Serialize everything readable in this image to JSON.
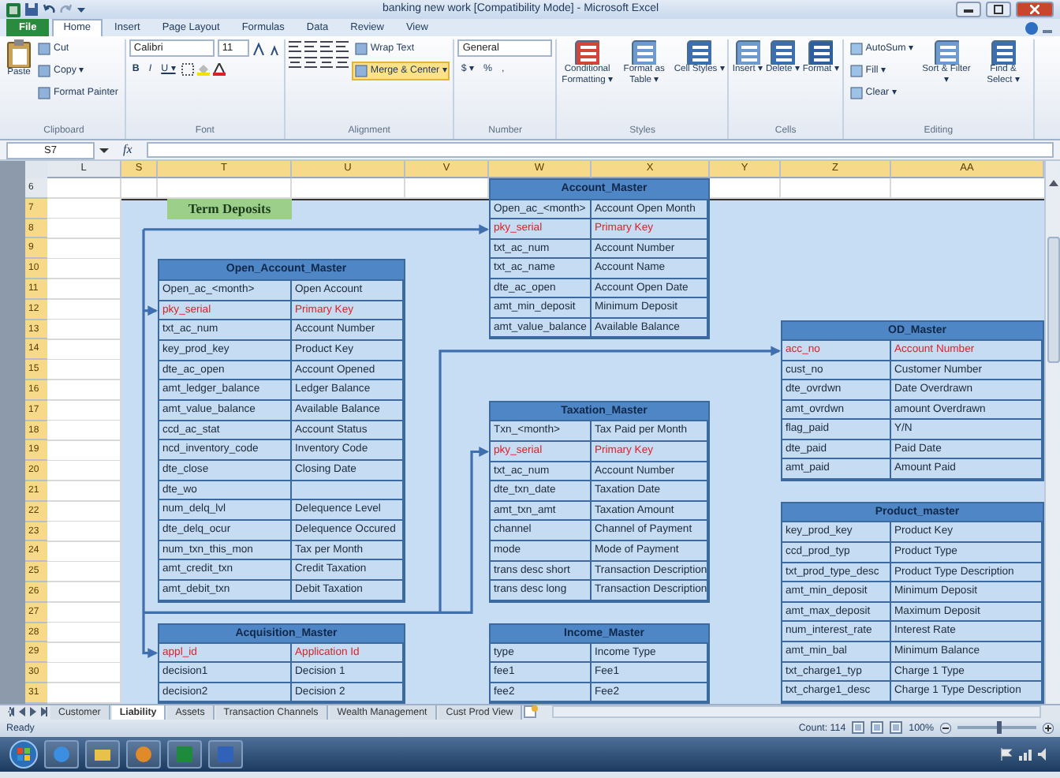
{
  "window": {
    "title": "banking new work [Compatibility Mode] - Microsoft Excel"
  },
  "ribbon": {
    "tabs": [
      {
        "label": "File",
        "selected": false,
        "kind": "file"
      },
      {
        "label": "Home",
        "selected": true,
        "kind": "tab"
      },
      {
        "label": "Insert",
        "selected": false,
        "kind": "tab"
      },
      {
        "label": "Page Layout",
        "selected": false,
        "kind": "tab"
      },
      {
        "label": "Formulas",
        "selected": false,
        "kind": "tab"
      },
      {
        "label": "Data",
        "selected": false,
        "kind": "tab"
      },
      {
        "label": "Review",
        "selected": false,
        "kind": "tab"
      },
      {
        "label": "View",
        "selected": false,
        "kind": "tab"
      }
    ],
    "groups": [
      {
        "kind": "clipboard",
        "label": "Clipboard",
        "big": "Paste",
        "small": [
          "Cut",
          "Copy ▾",
          "Format Painter"
        ]
      },
      {
        "kind": "font",
        "label": "Font",
        "font_name": "Calibri",
        "font_size": "11",
        "buttons": [
          "B",
          "I",
          "U ▾"
        ]
      },
      {
        "kind": "alignment",
        "label": "Alignment",
        "small": [
          {
            "label": "Wrap Text",
            "selected": false
          },
          {
            "label": "Merge & Center ▾",
            "selected": true
          }
        ]
      },
      {
        "kind": "number",
        "label": "Number",
        "format": "General",
        "buttons": [
          "$ ▾",
          "%",
          ","
        ]
      },
      {
        "kind": "big",
        "label": "Styles",
        "big": [
          "Conditional Formatting ▾",
          "Format as Table ▾",
          "Cell Styles ▾"
        ]
      },
      {
        "kind": "big",
        "label": "Cells",
        "big": [
          "Insert ▾",
          "Delete ▾",
          "Format ▾"
        ]
      },
      {
        "kind": "editing",
        "label": "Editing",
        "small": [
          "AutoSum ▾",
          "Fill ▾",
          "Clear ▾"
        ],
        "big": [
          "Sort & Filter ▾",
          "Find & Select ▾"
        ]
      }
    ]
  },
  "formula_bar": {
    "name_box": "S7",
    "fx": "fx"
  },
  "sheet": {
    "columns": [
      {
        "label": "L",
        "selected": false
      },
      {
        "label": "S",
        "selected": true
      },
      {
        "label": "T",
        "selected": true
      },
      {
        "label": "U",
        "selected": true
      },
      {
        "label": "V",
        "selected": true
      },
      {
        "label": "W",
        "selected": true
      },
      {
        "label": "X",
        "selected": true
      },
      {
        "label": "Y",
        "selected": true
      },
      {
        "label": "Z",
        "selected": true
      },
      {
        "label": "AA",
        "selected": true
      }
    ],
    "rows": [
      {
        "label": "6",
        "selected": false
      },
      {
        "label": "7",
        "selected": true
      },
      {
        "label": "8",
        "selected": true
      },
      {
        "label": "9",
        "selected": true
      },
      {
        "label": "10",
        "selected": true
      },
      {
        "label": "11",
        "selected": true
      },
      {
        "label": "12",
        "selected": true
      },
      {
        "label": "13",
        "selected": true
      },
      {
        "label": "14",
        "selected": true
      },
      {
        "label": "15",
        "selected": true
      },
      {
        "label": "16",
        "selected": true
      },
      {
        "label": "17",
        "selected": true
      },
      {
        "label": "18",
        "selected": true
      },
      {
        "label": "19",
        "selected": true
      },
      {
        "label": "20",
        "selected": true
      },
      {
        "label": "21",
        "selected": true
      },
      {
        "label": "22",
        "selected": true
      },
      {
        "label": "23",
        "selected": true
      },
      {
        "label": "24",
        "selected": true
      },
      {
        "label": "25",
        "selected": true
      },
      {
        "label": "26",
        "selected": true
      },
      {
        "label": "27",
        "selected": true
      },
      {
        "label": "28",
        "selected": true
      },
      {
        "label": "29",
        "selected": true
      },
      {
        "label": "30",
        "selected": true
      },
      {
        "label": "31",
        "selected": true
      }
    ]
  },
  "diagram": {
    "title_box": "Term Deposits",
    "tables": [
      {
        "title": "Account_Master",
        "fields": [
          {
            "name": "Open_ac_<month>",
            "description": "Account Open Month",
            "key": false
          },
          {
            "name": "pky_serial",
            "description": "Primary Key",
            "key": true
          },
          {
            "name": "txt_ac_num",
            "description": "Account Number",
            "key": false
          },
          {
            "name": "txt_ac_name",
            "description": "Account Name",
            "key": false
          },
          {
            "name": "dte_ac_open",
            "description": "Account Open Date",
            "key": false
          },
          {
            "name": "amt_min_deposit",
            "description": "Minimum Deposit",
            "key": false
          },
          {
            "name": "amt_value_balance",
            "description": "Available Balance",
            "key": false
          }
        ]
      },
      {
        "title": "Open_Account_Master",
        "fields": [
          {
            "name": "Open_ac_<month>",
            "description": "Open Account",
            "key": false
          },
          {
            "name": "pky_serial",
            "description": "Primary Key",
            "key": true
          },
          {
            "name": "txt_ac_num",
            "description": "Account Number",
            "key": false
          },
          {
            "name": "key_prod_key",
            "description": "Product Key",
            "key": false
          },
          {
            "name": "dte_ac_open",
            "description": "Account Opened",
            "key": false
          },
          {
            "name": "amt_ledger_balance",
            "description": "Ledger Balance",
            "key": false
          },
          {
            "name": "amt_value_balance",
            "description": "Available Balance",
            "key": false
          },
          {
            "name": "ccd_ac_stat",
            "description": "Account Status",
            "key": false
          },
          {
            "name": "ncd_inventory_code",
            "description": "Inventory Code",
            "key": false
          },
          {
            "name": "dte_close",
            "description": "Closing Date",
            "key": false
          },
          {
            "name": "dte_wo",
            "key": false
          },
          {
            "name": "num_delq_lvl",
            "description": "Delequence Level",
            "key": false
          },
          {
            "name": "dte_delq_ocur",
            "description": "Delequence Occured",
            "key": false
          },
          {
            "name": "num_txn_this_mon",
            "description": "Tax per Month",
            "key": false
          },
          {
            "name": "amt_credit_txn",
            "description": "Credit Taxation",
            "key": false
          },
          {
            "name": "amt_debit_txn",
            "description": "Debit Taxation",
            "key": false
          }
        ]
      },
      {
        "title": "OD_Master",
        "fields": [
          {
            "name": "acc_no",
            "description": "Account Number",
            "key": true
          },
          {
            "name": "cust_no",
            "description": "Customer Number",
            "key": false
          },
          {
            "name": "dte_ovrdwn",
            "description": "Date Overdrawn",
            "key": false
          },
          {
            "name": "amt_ovrdwn",
            "description": "amount Overdrawn",
            "key": false
          },
          {
            "name": "flag_paid",
            "description": "Y/N",
            "key": false
          },
          {
            "name": "dte_paid",
            "description": "Paid Date",
            "key": false
          },
          {
            "name": "amt_paid",
            "description": "Amount Paid",
            "key": false
          }
        ]
      },
      {
        "title": "Taxation_Master",
        "fields": [
          {
            "name": "Txn_<month>",
            "description": "Tax Paid per Month",
            "key": false
          },
          {
            "name": "pky_serial",
            "description": "Primary Key",
            "key": true
          },
          {
            "name": "txt_ac_num",
            "description": "Account Number",
            "key": false
          },
          {
            "name": "dte_txn_date",
            "description": "Taxation Date",
            "key": false
          },
          {
            "name": "amt_txn_amt",
            "description": "Taxation Amount",
            "key": false
          },
          {
            "name": "channel",
            "description": "Channel of Payment",
            "key": false
          },
          {
            "name": "mode",
            "description": "Mode of Payment",
            "key": false
          },
          {
            "name": "trans desc short",
            "description": "Transaction Description",
            "key": false
          },
          {
            "name": "trans desc long",
            "description": "Transaction Description",
            "key": false
          }
        ]
      },
      {
        "title": "Acquisition_Master",
        "fields": [
          {
            "name": "appl_id",
            "description": "Application Id",
            "key": true
          },
          {
            "name": "decision1",
            "description": "Decision 1",
            "key": false
          },
          {
            "name": "decision2",
            "description": "Decision 2",
            "key": false
          }
        ]
      },
      {
        "title": "Income_Master",
        "fields": [
          {
            "name": "type",
            "description": "Income Type",
            "key": false
          },
          {
            "name": "fee1",
            "description": "Fee1",
            "key": false
          },
          {
            "name": "fee2",
            "description": "Fee2",
            "key": false
          }
        ]
      },
      {
        "title": "Product_master",
        "fields": [
          {
            "name": "key_prod_key",
            "description": "Product Key",
            "key": false
          },
          {
            "name": "ccd_prod_typ",
            "description": "Product Type",
            "key": false
          },
          {
            "name": "txt_prod_type_desc",
            "description": "Product Type Description",
            "key": false
          },
          {
            "name": "amt_min_deposit",
            "description": "Minimum Deposit",
            "key": false
          },
          {
            "name": "amt_max_deposit",
            "description": "Maximum Deposit",
            "key": false
          },
          {
            "name": "num_interest_rate",
            "description": "Interest Rate",
            "key": false
          },
          {
            "name": "amt_min_bal",
            "description": "Minimum Balance",
            "key": false
          },
          {
            "name": "txt_charge1_typ",
            "description": "Charge 1 Type",
            "key": false
          },
          {
            "name": "txt_charge1_desc",
            "description": "Charge 1 Type Description",
            "key": false
          }
        ]
      }
    ]
  },
  "sheet_tabs": [
    {
      "label": "Customer",
      "selected": false
    },
    {
      "label": "Liability",
      "selected": true
    },
    {
      "label": "Assets",
      "selected": false
    },
    {
      "label": "Transaction Channels",
      "selected": false
    },
    {
      "label": "Wealth Management",
      "selected": false
    },
    {
      "label": "Cust Prod View",
      "selected": false
    }
  ],
  "status_bar": {
    "mode": "Ready",
    "count": "Count: 114",
    "zoom": "100%",
    "zoom_slider": {
      "level": 0.5
    }
  }
}
